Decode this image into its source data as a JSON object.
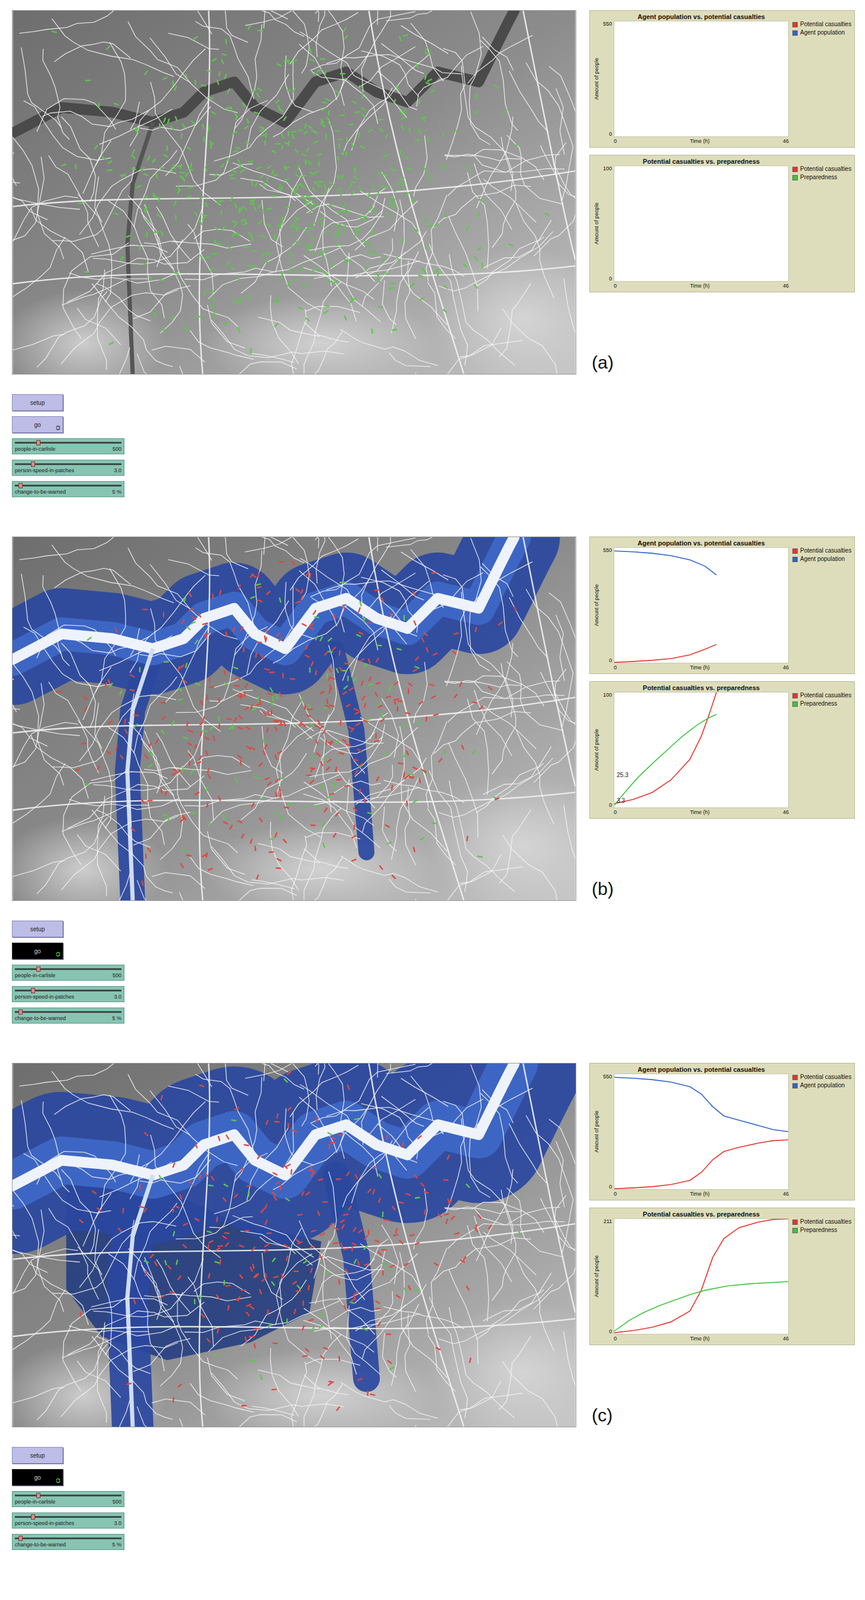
{
  "figures": [
    {
      "label": "(a)",
      "map": {
        "flood_level": 0,
        "agents": [
          {
            "kind": "safe",
            "color": "#5cc84a",
            "count": 500
          }
        ]
      },
      "plots": [
        {
          "title": "Agent population vs. potential casualties",
          "y_label": "Amount of people",
          "x_label": "Time (h)",
          "y_ticks": [
            "550",
            "0"
          ],
          "x_ticks": [
            "0",
            "46"
          ],
          "value_labels": [],
          "series": [
            {
              "name": "Potential casualties",
              "color": "#e8332a",
              "points": []
            },
            {
              "name": "Agent population",
              "color": "#2e62d0",
              "points": []
            }
          ]
        },
        {
          "title": "Potential casualties vs. preparedness",
          "y_label": "Amount of people",
          "x_label": "Time (h)",
          "y_ticks": [
            "100",
            "0"
          ],
          "x_ticks": [
            "0",
            "46"
          ],
          "value_labels": [],
          "series": [
            {
              "name": "Potential casualties",
              "color": "#e8332a",
              "points": []
            },
            {
              "name": "Preparedness",
              "color": "#3cc43c",
              "points": []
            }
          ]
        }
      ],
      "buttons": [
        {
          "label": "setup",
          "kind": "once",
          "pressed": false
        },
        {
          "label": "go",
          "kind": "forever",
          "pressed": false
        }
      ],
      "sliders": [
        {
          "label": "people-in-carlisle",
          "value": "500",
          "level": 0.22
        },
        {
          "label": "person-speed-in-patches",
          "value": "3.0",
          "level": 0.17
        },
        {
          "label": "change-to-be-warned",
          "value": "5 %",
          "level": 0.05
        }
      ]
    },
    {
      "label": "(b)",
      "map": {
        "flood_level": 0.6,
        "agents": [
          {
            "kind": "safe",
            "color": "#5cc84a",
            "count": 110
          },
          {
            "kind": "affected",
            "color": "#e0483e",
            "count": 320
          }
        ]
      },
      "plots": [
        {
          "title": "Agent population vs. potential casualties",
          "y_label": "Amount of people",
          "x_label": "Time (h)",
          "y_ticks": [
            "550",
            "0"
          ],
          "x_ticks": [
            "0",
            "46"
          ],
          "value_labels": [],
          "series": [
            {
              "name": "Potential casualties",
              "color": "#e8332a",
              "points": [
                [
                  0,
                  2
                ],
                [
                  5,
                  6
                ],
                [
                  10,
                  12
                ],
                [
                  15,
                  20
                ],
                [
                  20,
                  38
                ],
                [
                  24,
                  65
                ],
                [
                  27,
                  88
                ]
              ]
            },
            {
              "name": "Agent population",
              "color": "#2e62d0",
              "points": [
                [
                  0,
                  535
                ],
                [
                  5,
                  531
                ],
                [
                  10,
                  524
                ],
                [
                  15,
                  512
                ],
                [
                  20,
                  492
                ],
                [
                  24,
                  462
                ],
                [
                  27,
                  420
                ]
              ]
            }
          ]
        },
        {
          "title": "Potential casualties vs. preparedness",
          "y_label": "Amount of people",
          "x_label": "Time (h)",
          "y_ticks": [
            "100",
            "0"
          ],
          "x_ticks": [
            "0",
            "46"
          ],
          "value_labels": [
            "25.3",
            "3.3"
          ],
          "series": [
            {
              "name": "Potential casualties",
              "color": "#e8332a",
              "points": [
                [
                  0,
                  3.3
                ],
                [
                  5,
                  7
                ],
                [
                  10,
                  13
                ],
                [
                  15,
                  24
                ],
                [
                  20,
                  42
                ],
                [
                  23,
                  62
                ],
                [
                  25,
                  80
                ],
                [
                  27,
                  100
                ]
              ]
            },
            {
              "name": "Preparedness",
              "color": "#3cc43c",
              "points": [
                [
                  0,
                  2
                ],
                [
                  3,
                  14
                ],
                [
                  6,
                  25.3
                ],
                [
                  10,
                  38
                ],
                [
                  14,
                  50
                ],
                [
                  18,
                  62
                ],
                [
                  22,
                  72
                ],
                [
                  25,
                  78
                ],
                [
                  27,
                  81
                ]
              ]
            }
          ]
        }
      ],
      "buttons": [
        {
          "label": "setup",
          "kind": "once",
          "pressed": false
        },
        {
          "label": "go",
          "kind": "forever",
          "pressed": true
        }
      ],
      "sliders": [
        {
          "label": "people-in-carlisle",
          "value": "500",
          "level": 0.22
        },
        {
          "label": "person-speed-in-patches",
          "value": "3.0",
          "level": 0.17
        },
        {
          "label": "change-to-be-warned",
          "value": "5 %",
          "level": 0.05
        }
      ]
    },
    {
      "label": "(c)",
      "map": {
        "flood_level": 1,
        "agents": [
          {
            "kind": "safe",
            "color": "#5cc84a",
            "count": 45
          },
          {
            "kind": "affected",
            "color": "#e0483e",
            "count": 230
          }
        ]
      },
      "plots": [
        {
          "title": "Agent population vs. potential casualties",
          "y_label": "Amount of people",
          "x_label": "Time (h)",
          "y_ticks": [
            "550",
            "0"
          ],
          "x_ticks": [
            "0",
            "46"
          ],
          "value_labels": [],
          "series": [
            {
              "name": "Potential casualties",
              "color": "#e8332a",
              "points": [
                [
                  0,
                  2
                ],
                [
                  5,
                  6
                ],
                [
                  10,
                  12
                ],
                [
                  15,
                  22
                ],
                [
                  20,
                  42
                ],
                [
                  23,
                  80
                ],
                [
                  26,
                  140
                ],
                [
                  29,
                  180
                ],
                [
                  33,
                  200
                ],
                [
                  38,
                  220
                ],
                [
                  42,
                  232
                ],
                [
                  46,
                  236
                ]
              ]
            },
            {
              "name": "Agent population",
              "color": "#2e62d0",
              "points": [
                [
                  0,
                  535
                ],
                [
                  5,
                  531
                ],
                [
                  10,
                  524
                ],
                [
                  15,
                  512
                ],
                [
                  20,
                  490
                ],
                [
                  23,
                  455
                ],
                [
                  26,
                  395
                ],
                [
                  29,
                  350
                ],
                [
                  33,
                  330
                ],
                [
                  38,
                  305
                ],
                [
                  42,
                  285
                ],
                [
                  46,
                  275
                ]
              ]
            }
          ]
        },
        {
          "title": "Potential casualties vs. preparedness",
          "y_label": "Amount of people",
          "x_label": "Time (h)",
          "y_ticks": [
            "211",
            "0"
          ],
          "x_ticks": [
            "0",
            "46"
          ],
          "value_labels": [],
          "series": [
            {
              "name": "Potential casualties",
              "color": "#e8332a",
              "points": [
                [
                  0,
                  2
                ],
                [
                  5,
                  6
                ],
                [
                  10,
                  12
                ],
                [
                  15,
                  22
                ],
                [
                  20,
                  42
                ],
                [
                  23,
                  80
                ],
                [
                  26,
                  140
                ],
                [
                  29,
                  175
                ],
                [
                  33,
                  195
                ],
                [
                  38,
                  205
                ],
                [
                  42,
                  210
                ],
                [
                  46,
                  211
                ]
              ]
            },
            {
              "name": "Preparedness",
              "color": "#3cc43c",
              "points": [
                [
                  0,
                  5
                ],
                [
                  4,
                  25
                ],
                [
                  8,
                  40
                ],
                [
                  12,
                  52
                ],
                [
                  16,
                  62
                ],
                [
                  20,
                  72
                ],
                [
                  24,
                  80
                ],
                [
                  30,
                  88
                ],
                [
                  36,
                  92
                ],
                [
                  46,
                  96
                ]
              ]
            }
          ]
        }
      ],
      "buttons": [
        {
          "label": "setup",
          "kind": "once",
          "pressed": false
        },
        {
          "label": "go",
          "kind": "forever",
          "pressed": true
        }
      ],
      "sliders": [
        {
          "label": "people-in-carlisle",
          "value": "500",
          "level": 0.22
        },
        {
          "label": "person-speed-in-patches",
          "value": "3.0",
          "level": 0.17
        },
        {
          "label": "change-to-be-warned",
          "value": "5 %",
          "level": 0.05
        }
      ]
    }
  ]
}
